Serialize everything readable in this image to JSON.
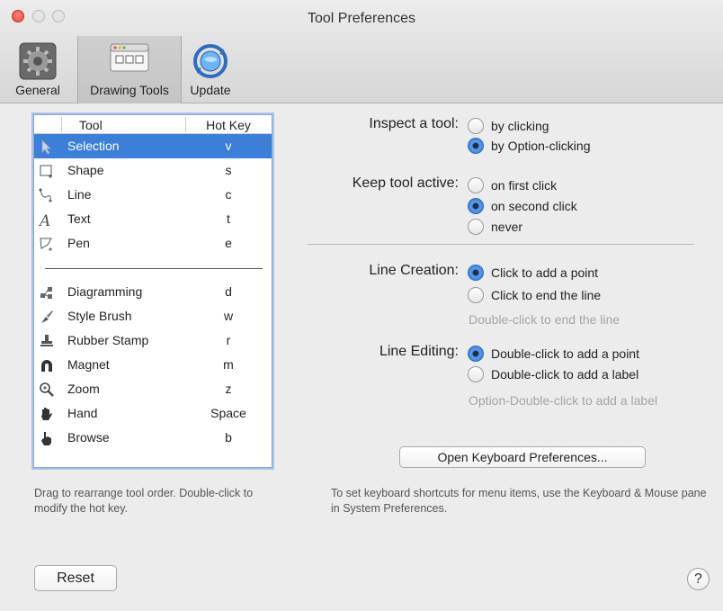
{
  "window": {
    "title": "Tool Preferences"
  },
  "toolbar": {
    "general_label": "General",
    "drawing_tools_label": "Drawing Tools",
    "update_label": "Update"
  },
  "tool_list": {
    "header_tool": "Tool",
    "header_hotkey": "Hot Key",
    "rows": [
      {
        "name": "Selection",
        "key": "v",
        "icon": "arrow-pointer-icon",
        "selected": true
      },
      {
        "name": "Shape",
        "key": "s",
        "icon": "shape-icon"
      },
      {
        "name": "Line",
        "key": "c",
        "icon": "line-tool-icon"
      },
      {
        "name": "Text",
        "key": "t",
        "icon": "text-tool-icon"
      },
      {
        "name": "Pen",
        "key": "e",
        "icon": "pen-tool-icon"
      },
      {
        "name": "Diagramming",
        "key": "d",
        "icon": "diagramming-icon"
      },
      {
        "name": "Style Brush",
        "key": "w",
        "icon": "style-brush-icon"
      },
      {
        "name": "Rubber Stamp",
        "key": "r",
        "icon": "rubber-stamp-icon"
      },
      {
        "name": "Magnet",
        "key": "m",
        "icon": "magnet-icon"
      },
      {
        "name": "Zoom",
        "key": "z",
        "icon": "zoom-icon"
      },
      {
        "name": "Hand",
        "key": "Space",
        "icon": "hand-icon"
      },
      {
        "name": "Browse",
        "key": "b",
        "icon": "browse-hand-icon"
      }
    ]
  },
  "hints": {
    "left": "Drag to rearrange tool order.  Double-click to modify the hot key.",
    "right": "To set keyboard shortcuts for menu items, use the Keyboard & Mouse pane in System Preferences."
  },
  "inspect": {
    "label": "Inspect a tool:",
    "options": [
      "by clicking",
      "by Option-clicking"
    ],
    "selected": 1
  },
  "keep_active": {
    "label": "Keep tool active:",
    "options": [
      "on first click",
      "on second click",
      "never"
    ],
    "selected": 1
  },
  "line_creation": {
    "label": "Line Creation:",
    "options": [
      "Click to add a point",
      "Click to end the line"
    ],
    "selected": 0,
    "note": "Double-click to end the line"
  },
  "line_editing": {
    "label": "Line Editing:",
    "options": [
      "Double-click to add a point",
      "Double-click to add a label"
    ],
    "selected": 0,
    "note": "Option-Double-click to add a label"
  },
  "buttons": {
    "open_keyboard": "Open Keyboard Preferences...",
    "reset": "Reset",
    "help": "?"
  },
  "colors": {
    "selection": "#3b7fd8",
    "accent": "#3b7fd8"
  }
}
